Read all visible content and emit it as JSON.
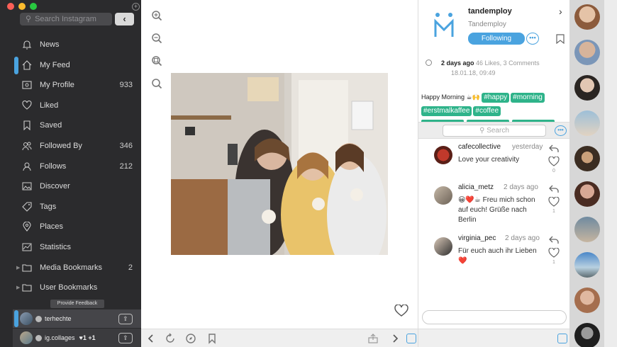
{
  "window": {
    "traffic_colors": [
      "#fc5f57",
      "#fdbc2e",
      "#28c840"
    ]
  },
  "sidebar": {
    "search_placeholder": "Search Instagram",
    "collapse_label": "‹",
    "add_account_label": "+",
    "items": [
      {
        "label": "News",
        "count": "",
        "icon": "bell-icon"
      },
      {
        "label": "My Feed",
        "count": "",
        "icon": "home-icon",
        "selected": true
      },
      {
        "label": "My Profile",
        "count": "933",
        "icon": "profile-card-icon"
      },
      {
        "label": "Liked",
        "count": "",
        "icon": "heart-icon"
      },
      {
        "label": "Saved",
        "count": "",
        "icon": "bookmark-icon"
      },
      {
        "label": "Followed By",
        "count": "346",
        "icon": "users-icon"
      },
      {
        "label": "Follows",
        "count": "212",
        "icon": "user-icon"
      },
      {
        "label": "Discover",
        "count": "",
        "icon": "image-icon"
      },
      {
        "label": "Tags",
        "count": "",
        "icon": "tag-icon"
      },
      {
        "label": "Places",
        "count": "",
        "icon": "pin-icon"
      },
      {
        "label": "Statistics",
        "count": "",
        "icon": "chart-icon"
      },
      {
        "label": "Media Bookmarks",
        "count": "2",
        "icon": "folder-icon",
        "expandable": true
      },
      {
        "label": "User Bookmarks",
        "count": "",
        "icon": "folder-icon",
        "expandable": true
      }
    ],
    "feedback_label": "Provide Feedback",
    "accounts": [
      {
        "name": "terhechte",
        "extra": ""
      },
      {
        "name": "ig.collages",
        "extra": "♥1 +1"
      }
    ]
  },
  "post": {
    "username": "tandemploy",
    "full_name": "Tandemploy",
    "follow_label": "Following",
    "more_label": "•••",
    "time_ago": "2 days ago",
    "stats": "46 Likes, 3 Comments",
    "date": "18.01.18, 09:49",
    "caption_text": "Happy Morning ☕🙌",
    "tags": [
      "#happy",
      "#morning",
      "#erstmalkaffee",
      "#coffee"
    ]
  },
  "comments_bar": {
    "search_placeholder": "Search",
    "more_label": "•••"
  },
  "comments": [
    {
      "user": "cafecollective",
      "time": "yesterday",
      "text": "Love your creativity",
      "likes": "0"
    },
    {
      "user": "alicia_metz",
      "time": "2 days ago",
      "text": "😀❤️☕ Freu mich schon auf euch! Grüße nach Berlin",
      "likes": "1"
    },
    {
      "user": "virginia_pec",
      "time": "2 days ago",
      "text": "Für euch auch ihr Lieben ❤️",
      "likes": "1"
    }
  ],
  "colors": {
    "accent": "#4aa3df",
    "tag": "#2eb38a",
    "sidebar_bg": "#2b2b2d"
  }
}
